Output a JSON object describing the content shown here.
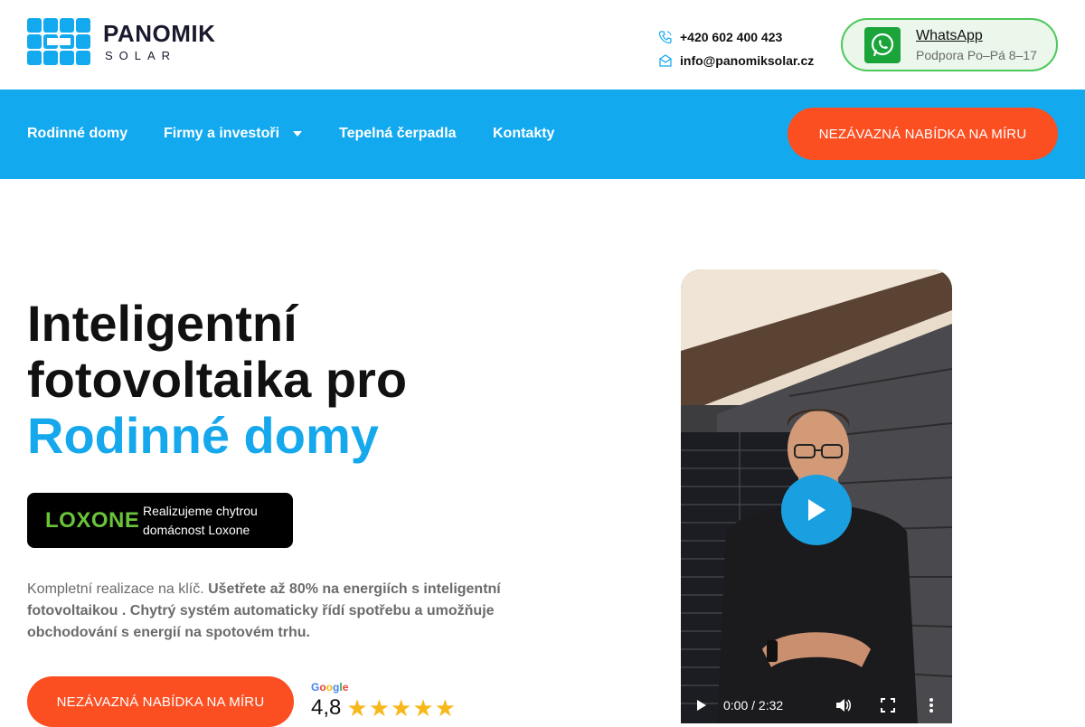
{
  "brand": {
    "name": "PANOMIK",
    "sub": "SOLAR"
  },
  "contact": {
    "phone": "+420 602 400 423",
    "email": "info@panomiksolar.cz"
  },
  "whatsapp": {
    "title": "WhatsApp",
    "subtitle": "Podpora Po–Pá 8–17"
  },
  "nav": {
    "items": [
      {
        "label": "Rodinné domy"
      },
      {
        "label": "Firmy a investoři"
      },
      {
        "label": "Tepelná čerpadla"
      },
      {
        "label": "Kontakty"
      }
    ],
    "cta": "NEZÁVAZNÁ NABÍDKA NA MÍRU"
  },
  "hero": {
    "title_line1": "Inteligentní",
    "title_line2": "fotovoltaika pro",
    "title_accent": "Rodinné domy",
    "loxone_logo": "LOXONE",
    "loxone_text_1": "Realizujeme chytrou",
    "loxone_text_2": "domácnost Loxone",
    "desc_plain": "Kompletní realizace na klíč. ",
    "desc_bold": "Ušetřete až 80% na energiích s inteligentní fotovoltaikou . Chytrý systém automaticky řídí spotřebu a umožňuje obchodování s energií na spotovém trhu.",
    "cta": "NEZÁVAZNÁ NABÍDKA NA MÍRU"
  },
  "rating": {
    "provider": "Google",
    "score": "4,8",
    "stars": 5
  },
  "video": {
    "time": "0:00 / 2:32"
  },
  "colors": {
    "accent": "#12a9ef",
    "cta": "#fb4f22",
    "whatsapp": "#4cc85a",
    "loxone": "#6ac43a",
    "star": "#f7b81b"
  },
  "icons": {
    "phone": "phone-icon",
    "email": "mail-icon",
    "whatsapp": "whatsapp-icon",
    "dropdown": "caret-down-icon",
    "play": "play-icon",
    "volume": "volume-icon",
    "fullscreen": "fullscreen-icon",
    "more": "more-vertical-icon"
  }
}
